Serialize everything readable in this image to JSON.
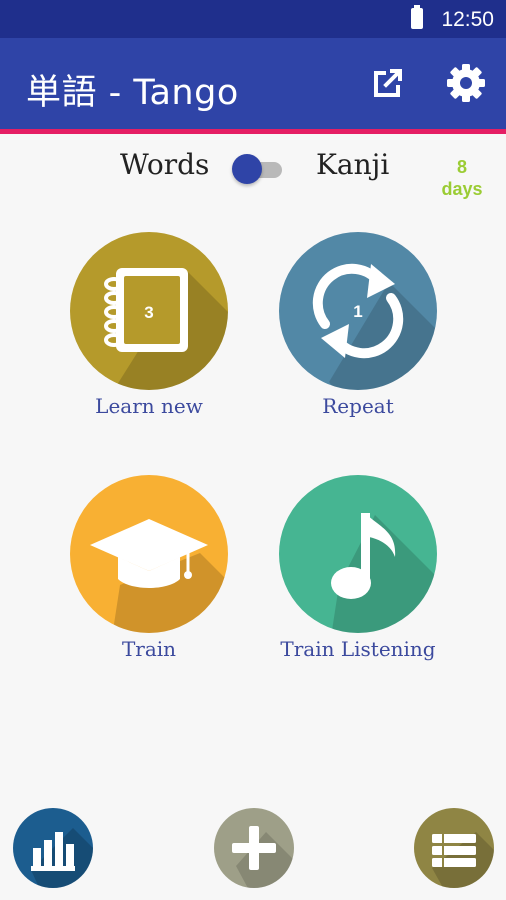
{
  "status_bar": {
    "time": "12:50"
  },
  "app_bar": {
    "title": "単語 - Tango"
  },
  "mode_toggle": {
    "left_label": "Words",
    "right_label": "Kanji",
    "state": "words"
  },
  "streak": {
    "count": "8",
    "unit": "days"
  },
  "tiles": [
    {
      "label": "Learn new",
      "badge": "3",
      "icon": "notebook-icon",
      "color": "#b59a2b"
    },
    {
      "label": "Repeat",
      "badge": "1",
      "icon": "repeat-icon",
      "color": "#5288a6"
    },
    {
      "label": "Train",
      "icon": "graduation-cap-icon",
      "color": "#f8b033"
    },
    {
      "label": "Train Listening",
      "icon": "music-note-icon",
      "color": "#46b592"
    }
  ],
  "bottom_bar": {
    "left_icon": "stats-icon",
    "center_icon": "add-icon",
    "right_icon": "list-icon"
  },
  "colors": {
    "primary": "#2f44a7",
    "accent": "#e51e64",
    "status_bar": "#1f2f8c",
    "streak": "#9bcc34"
  }
}
